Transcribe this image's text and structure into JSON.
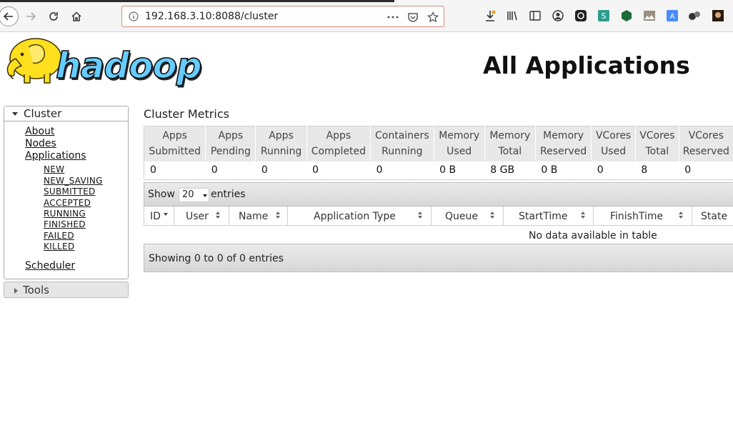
{
  "browser": {
    "url": "192.168.3.10:8088/cluster"
  },
  "header": {
    "logo_text": "hadoop",
    "title": "All Applications"
  },
  "sidebar": {
    "cluster_label": "Cluster",
    "links": {
      "about": "About",
      "nodes": "Nodes",
      "applications": "Applications",
      "scheduler": "Scheduler"
    },
    "app_states": [
      "NEW",
      "NEW_SAVING",
      "SUBMITTED",
      "ACCEPTED",
      "RUNNING",
      "FINISHED",
      "FAILED",
      "KILLED"
    ],
    "tools_label": "Tools"
  },
  "metrics": {
    "title": "Cluster Metrics",
    "headers": [
      [
        "Apps",
        "Submitted"
      ],
      [
        "Apps",
        "Pending"
      ],
      [
        "Apps",
        "Running"
      ],
      [
        "Apps",
        "Completed"
      ],
      [
        "Containers",
        "Running"
      ],
      [
        "Memory",
        "Used"
      ],
      [
        "Memory",
        "Total"
      ],
      [
        "Memory",
        "Reserved"
      ],
      [
        "VCores",
        "Used"
      ],
      [
        "VCores",
        "Total"
      ],
      [
        "VCores",
        "Reserved"
      ]
    ],
    "values": [
      "0",
      "0",
      "0",
      "0",
      "0",
      "0 B",
      "8 GB",
      "0 B",
      "0",
      "8",
      "0"
    ]
  },
  "apps_table": {
    "show_label": "Show",
    "page_length": "20",
    "entries_label": "entries",
    "columns": [
      "ID",
      "User",
      "Name",
      "Application Type",
      "Queue",
      "StartTime",
      "FinishTime",
      "State"
    ],
    "empty_message": "No data available in table",
    "info": "Showing 0 to 0 of 0 entries"
  }
}
